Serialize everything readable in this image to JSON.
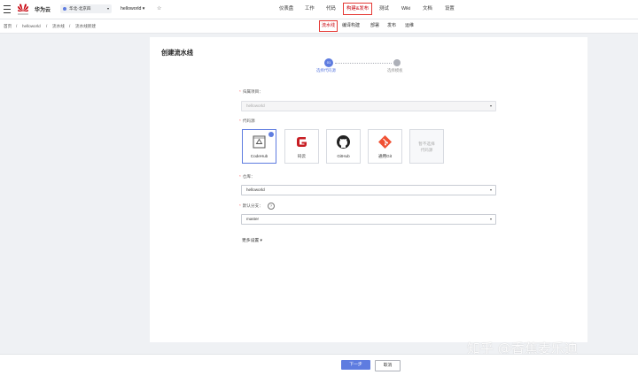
{
  "header": {
    "brand": "华为云",
    "region": "华北-北京四",
    "project": "helloworld ▾",
    "nav": [
      "仪表盘",
      "工作",
      "代码",
      "构建&发布",
      "测试",
      "Wiki",
      "文档",
      "设置"
    ],
    "active_nav": "构建&发布"
  },
  "breadcrumb": [
    "首页",
    "/",
    "helloworld",
    "/",
    "流水线",
    "/",
    "流水线新建"
  ],
  "subnav": [
    "流水线",
    "编译构建",
    "部署",
    "发布",
    "运维"
  ],
  "page": {
    "title": "创建流水线",
    "steps": [
      {
        "num": "01",
        "label": "选择代码源"
      },
      {
        "label": "选择模板"
      }
    ]
  },
  "form": {
    "project_label": "归属项目：",
    "project_value": "helloworld",
    "source_label": "代码源",
    "sources": [
      {
        "label": "CodeHub",
        "icon": "codehub-icon"
      },
      {
        "label": "码云",
        "icon": "gitee-icon"
      },
      {
        "label": "GitHub",
        "icon": "github-icon"
      },
      {
        "label": "通用Git",
        "icon": "git-icon"
      }
    ],
    "source_none": "暂不选择\n代码源",
    "repo_label": "仓库：",
    "repo_value": "helloworld",
    "branch_label": "默认分支：",
    "branch_value": "master",
    "more_settings": "更多设置 ▾"
  },
  "footer": {
    "next": "下一步",
    "cancel": "取消"
  },
  "watermark": "知乎 @香蕉麦乐迪",
  "colors": {
    "accent": "#5e7ce0",
    "highlight": "#e53935",
    "brand": "#c7000b"
  }
}
